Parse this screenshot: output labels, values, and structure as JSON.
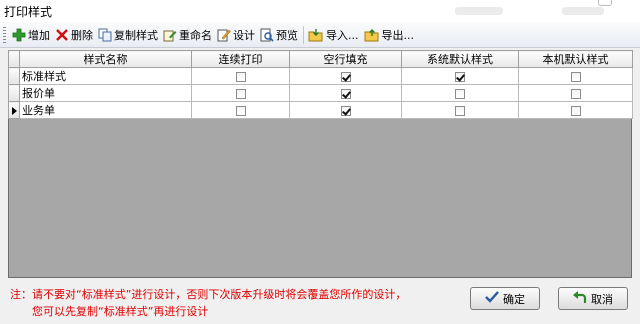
{
  "window": {
    "title": "打印样式"
  },
  "toolbar": {
    "items": [
      {
        "label": "增加",
        "icon": "add-icon"
      },
      {
        "label": "删除",
        "icon": "delete-icon"
      },
      {
        "label": "复制样式",
        "icon": "copy-icon"
      },
      {
        "label": "重命名",
        "icon": "rename-icon"
      },
      {
        "label": "设计",
        "icon": "design-icon"
      },
      {
        "label": "预览",
        "icon": "preview-icon"
      },
      {
        "label": "导入...",
        "icon": "import-icon"
      },
      {
        "label": "导出...",
        "icon": "export-icon"
      }
    ]
  },
  "grid": {
    "columns": [
      "样式名称",
      "连续打印",
      "空行填充",
      "系统默认样式",
      "本机默认样式"
    ],
    "rows": [
      {
        "name": "标准样式",
        "continuous": false,
        "fill_blank": true,
        "system_default": true,
        "local_default": false,
        "current": false
      },
      {
        "name": "报价单",
        "continuous": false,
        "fill_blank": true,
        "system_default": false,
        "local_default": false,
        "current": false
      },
      {
        "name": "业务单",
        "continuous": false,
        "fill_blank": true,
        "system_default": false,
        "local_default": false,
        "current": true
      }
    ]
  },
  "footer": {
    "note_line1": "注：请不要对“标准样式”进行设计，否则下次版本升级时将会覆盖您所作的设计，",
    "note_line2": "您可以先复制“标准样式”再进行设计",
    "ok_label": "确定",
    "back_label": "取消"
  },
  "colors": {
    "note": "#e00000",
    "add_icon": "#2e9b2e",
    "delete_icon": "#d01010"
  }
}
